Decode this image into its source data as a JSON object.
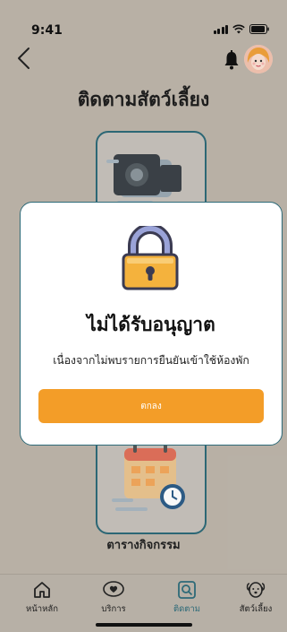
{
  "status": {
    "time": "9:41"
  },
  "page": {
    "title": "ติดตามสัตว์เลี้ยง"
  },
  "cards": [
    {
      "label": "",
      "icon": "camera-icon"
    },
    {
      "label": "ตารางกิจกรรม",
      "icon": "calendar-icon"
    }
  ],
  "modal": {
    "title": "ไม่ได้รับอนุญาต",
    "message": "เนื่องจากไม่พบรายการยืนยันเข้าใช้ห้องพัก",
    "ok_label": "ตกลง",
    "icon": "lock-icon"
  },
  "tabs": [
    {
      "label": "หน้าหลัก",
      "icon": "home-icon",
      "active": false
    },
    {
      "label": "บริการ",
      "icon": "heart-hand-icon",
      "active": false
    },
    {
      "label": "ติดตาม",
      "icon": "search-track-icon",
      "active": true
    },
    {
      "label": "สัตว์เลี้ยง",
      "icon": "dog-icon",
      "active": false
    }
  ],
  "colors": {
    "accent": "#f39d28",
    "teal": "#2d6a78",
    "background": "#bdb5aa"
  }
}
